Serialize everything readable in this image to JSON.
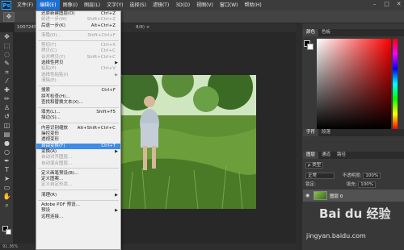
{
  "app": {
    "logo": "Ps",
    "menus": [
      "文件(F)",
      "编辑(E)",
      "图像(I)",
      "图层(L)",
      "文字(Y)",
      "选择(S)",
      "滤镜(T)",
      "3D(D)",
      "视图(V)",
      "窗口(W)",
      "帮助(H)"
    ],
    "active_menu_index": 1,
    "window_controls": [
      "–",
      "□",
      "✕"
    ]
  },
  "tabs": {
    "doc1": "1007245...",
    "doc2": "8/8) ×"
  },
  "status": {
    "zoom": "91.36%"
  },
  "edit_menu": {
    "items": [
      {
        "label": "还原新建图层(O)",
        "shortcut": "Ctrl+Z",
        "enabled": true
      },
      {
        "label": "前进一步(W)",
        "shortcut": "Shift+Ctrl+Z",
        "enabled": false
      },
      {
        "label": "后退一步(K)",
        "shortcut": "Alt+Ctrl+Z",
        "enabled": true
      },
      {
        "sep": true
      },
      {
        "label": "渐隐(D)...",
        "shortcut": "Shift+Ctrl+F",
        "enabled": false
      },
      {
        "sep": true
      },
      {
        "label": "剪切(T)",
        "shortcut": "Ctrl+X",
        "enabled": false
      },
      {
        "label": "拷贝(C)",
        "shortcut": "Ctrl+C",
        "enabled": false
      },
      {
        "label": "合并拷贝(Y)",
        "shortcut": "Shift+Ctrl+C",
        "enabled": false
      },
      {
        "label": "选择性拷贝",
        "submenu": true,
        "enabled": true
      },
      {
        "label": "粘贴(P)",
        "shortcut": "Ctrl+V",
        "enabled": false
      },
      {
        "label": "选择性粘贴(I)",
        "submenu": true,
        "enabled": false
      },
      {
        "label": "清除(E)",
        "enabled": false
      },
      {
        "sep": true
      },
      {
        "label": "搜索",
        "shortcut": "Ctrl+F",
        "enabled": true
      },
      {
        "label": "拼写检查(H)...",
        "enabled": true
      },
      {
        "label": "查找和替换文本(X)...",
        "enabled": true
      },
      {
        "sep": true
      },
      {
        "label": "填充(L)...",
        "shortcut": "Shift+F5",
        "enabled": true
      },
      {
        "label": "描边(S)...",
        "enabled": true
      },
      {
        "sep": true
      },
      {
        "label": "内容识别缩放",
        "shortcut": "Alt+Shift+Ctrl+C",
        "enabled": true
      },
      {
        "label": "操控变形",
        "enabled": true
      },
      {
        "label": "透视变形",
        "enabled": true
      },
      {
        "label": "自由变换(F)",
        "shortcut": "Ctrl+T",
        "enabled": true,
        "highlighted": true
      },
      {
        "label": "变换(A)",
        "submenu": true,
        "enabled": true
      },
      {
        "label": "自动对齐图层...",
        "enabled": false
      },
      {
        "label": "自动混合图层...",
        "enabled": false
      },
      {
        "sep": true
      },
      {
        "label": "定义画笔预设(B)...",
        "enabled": true
      },
      {
        "label": "定义图案...",
        "enabled": true
      },
      {
        "label": "定义自定形状...",
        "enabled": false
      },
      {
        "sep": true
      },
      {
        "label": "清理(R)",
        "submenu": true,
        "enabled": true
      },
      {
        "sep": true
      },
      {
        "label": "Adobe PDF 预设...",
        "enabled": true
      },
      {
        "label": "预设",
        "submenu": true,
        "enabled": true
      },
      {
        "label": "远程连接...",
        "enabled": true
      }
    ]
  },
  "panels": {
    "color_tabs": [
      "颜色",
      "色板"
    ],
    "mid_tabs": [
      "字符",
      "段落"
    ],
    "layer_tabs": [
      "图层",
      "通道",
      "路径"
    ],
    "kind_label": "ρ 类型",
    "blend_mode": "正常",
    "opacity_label": "不透明度:",
    "opacity_value": "100%",
    "lock_label": "锁定:",
    "fill_label": "填充:",
    "fill_value": "100%",
    "layer_name": "图层 0"
  },
  "watermark": {
    "text": "Bai du 经验",
    "url": "jingyan.baidu.com"
  },
  "colors": {
    "accent": "#3f8be6",
    "menu_active": "#1f6fd1"
  }
}
